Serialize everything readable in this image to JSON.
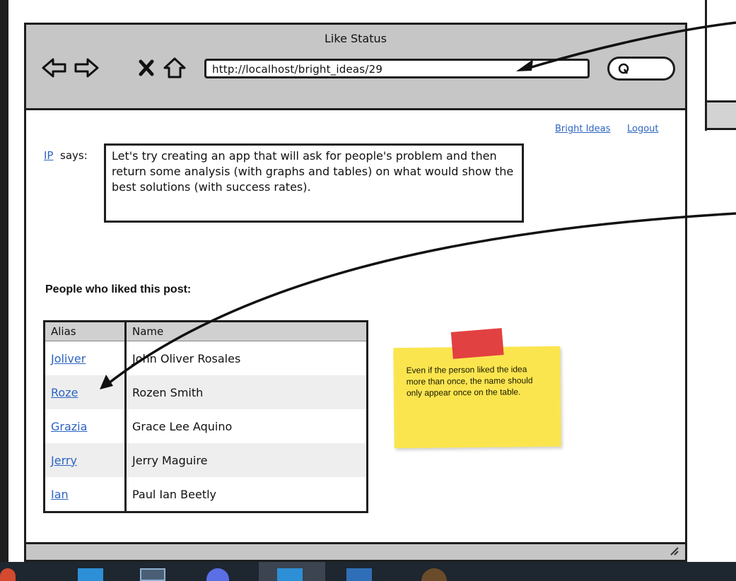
{
  "window": {
    "title": "Like Status"
  },
  "toolbar": {
    "url": "http://localhost/bright_ideas/29"
  },
  "nav_links": {
    "bright_ideas": "Bright Ideas",
    "logout": "Logout"
  },
  "post": {
    "author_alias": "IP",
    "says_label": "says:",
    "text": "Let's try creating an app that will ask for people's problem and then return some analysis (with graphs and tables) on what would show the best solutions (with success rates)."
  },
  "likes": {
    "heading": "People who liked this post:",
    "columns": [
      "Alias",
      "Name"
    ],
    "rows": [
      {
        "alias": "Joliver",
        "name": "John Oliver Rosales"
      },
      {
        "alias": "Roze",
        "name": "Rozen Smith"
      },
      {
        "alias": "Grazia",
        "name": "Grace Lee Aquino"
      },
      {
        "alias": "Jerry",
        "name": "Jerry Maguire"
      },
      {
        "alias": "Ian",
        "name": "Paul Ian Beetly"
      }
    ]
  },
  "sticky_note": {
    "text": "Even if the person liked the idea more than once, the name should only appear once on the table."
  },
  "colors": {
    "link": "#2c64c2",
    "chrome": "#c6c6c6",
    "sticky": "#fbe54f",
    "tape": "#e24141"
  },
  "icons": [
    "back-arrow-icon",
    "forward-arrow-icon",
    "close-icon",
    "home-icon",
    "search-icon"
  ]
}
